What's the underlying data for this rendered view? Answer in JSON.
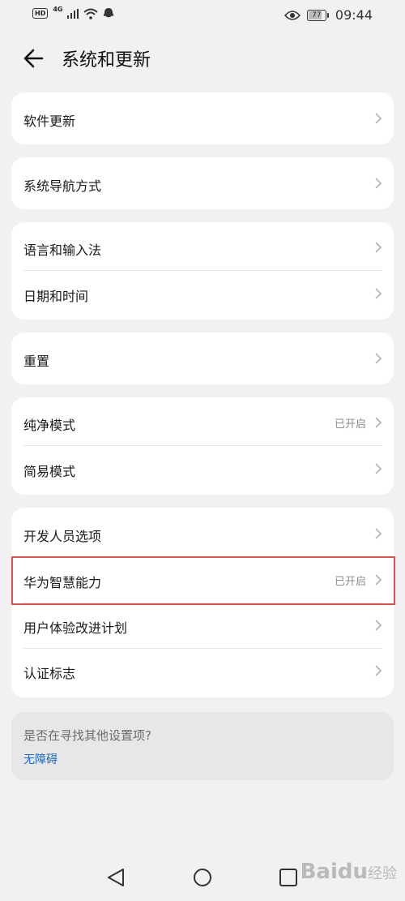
{
  "status_bar": {
    "hd": "HD",
    "network": "4G",
    "battery": "77",
    "time": "09:44"
  },
  "header": {
    "title": "系统和更新"
  },
  "menu": {
    "software_update": "软件更新",
    "system_navigation": "系统导航方式",
    "language_input": "语言和输入法",
    "date_time": "日期和时间",
    "reset": "重置",
    "pure_mode": "纯净模式",
    "pure_mode_status": "已开启",
    "simple_mode": "简易模式",
    "developer_options": "开发人员选项",
    "huawei_ai": "华为智慧能力",
    "huawei_ai_status": "已开启",
    "user_experience": "用户体验改进计划",
    "certification": "认证标志"
  },
  "search_suggestion": {
    "question": "是否在寻找其他设置项?",
    "link": "无障碍"
  },
  "watermark": {
    "brand": "Bai",
    "paw": "du",
    "sub": "经验"
  }
}
